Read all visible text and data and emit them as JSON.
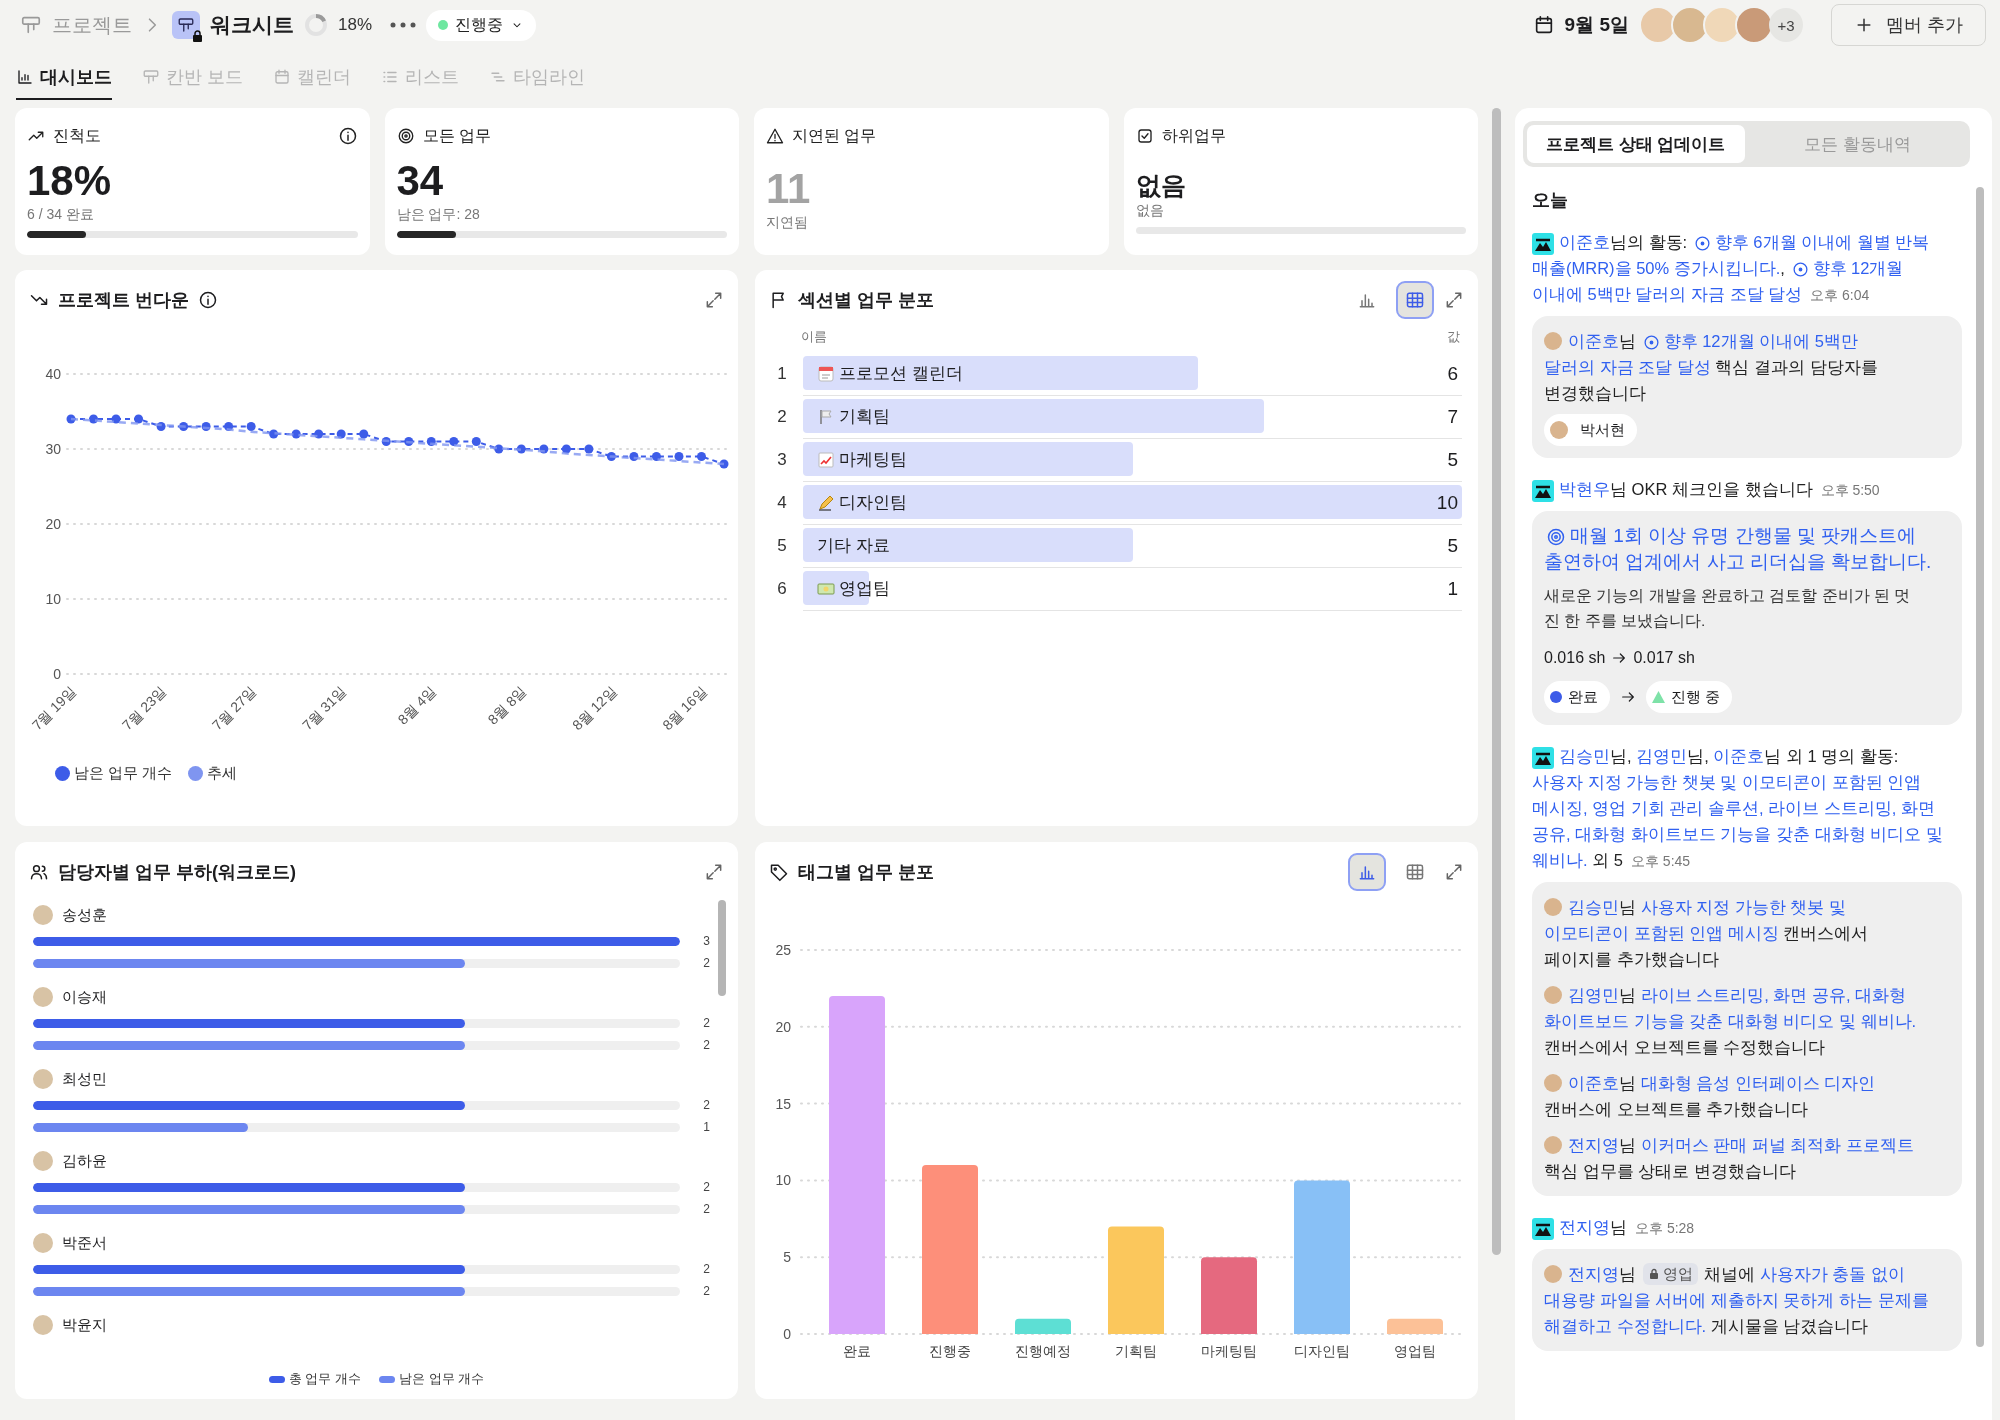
{
  "topbar": {
    "parent": "프로젝트",
    "title": "워크시트",
    "progress": {
      "level": 0.18,
      "reading": "18%"
    },
    "status": {
      "label": "진행중",
      "color": "#6ee7a0"
    },
    "date": "9월 5일",
    "members_more": "+3",
    "add_button": "멤버 추가"
  },
  "tabs": [
    {
      "label": "대시보드",
      "selected": true
    },
    {
      "label": "칸반 보드",
      "selected": false
    },
    {
      "label": "캘린더",
      "selected": false
    },
    {
      "label": "리스트",
      "selected": false
    },
    {
      "label": "타임라인",
      "selected": false
    }
  ],
  "stats": [
    {
      "kind": "percent",
      "title": "진척도",
      "info": true,
      "value": "18%",
      "caption": "6 / 34 완료",
      "level": 0.18
    },
    {
      "kind": "count",
      "title": "모든 업무",
      "info": false,
      "value": "34",
      "caption": "남은 업무: 28",
      "level": 0.18
    },
    {
      "kind": "overdue",
      "title": "지연된 업무",
      "info": false,
      "value": "11",
      "caption": "지연됨"
    },
    {
      "kind": "none",
      "title": "하위업무",
      "info": false,
      "value": "없음",
      "caption": "없음"
    }
  ],
  "burndown": {
    "title": "프로젝트 번다운",
    "chart_data": {
      "type": "line",
      "categories": [
        "7월 19일",
        null,
        null,
        null,
        "7월 23일",
        null,
        null,
        null,
        "7월 27일",
        null,
        null,
        null,
        "7월 31일",
        null,
        null,
        null,
        "8월 4일",
        null,
        null,
        null,
        "8월 8일",
        null,
        null,
        null,
        "8월 12일",
        null,
        null,
        null,
        "8월 16일",
        null
      ],
      "yticks": [
        0,
        10,
        20,
        30,
        40
      ],
      "ylim": [
        0,
        40
      ],
      "grid": true,
      "series": [
        {
          "name": "남은 업무 개수",
          "color": "#3d5ce8",
          "line_style": "dashed",
          "marker": "circle",
          "values": [
            34,
            34,
            34,
            34,
            33,
            33,
            33,
            33,
            33,
            32,
            32,
            32,
            32,
            32,
            31,
            31,
            31,
            31,
            31,
            30,
            30,
            30,
            30,
            30,
            29,
            29,
            29,
            29,
            29,
            28
          ]
        },
        {
          "name": "추세",
          "color": "#7f95f0",
          "line_style": "dashed",
          "values": [
            34,
            33.8,
            33.6,
            33.4,
            33.2,
            33,
            32.8,
            32.6,
            32.3,
            32.1,
            31.9,
            31.7,
            31.5,
            31.3,
            31.1,
            30.9,
            30.7,
            30.5,
            30.3,
            30.1,
            29.9,
            29.7,
            29.4,
            29.2,
            29,
            28.8,
            28.6,
            28.4,
            28.2,
            28
          ]
        }
      ]
    }
  },
  "sections": {
    "title": "섹션별 업무 분포",
    "views": [
      {
        "kind": "chart",
        "selected": false
      },
      {
        "kind": "table",
        "selected": true
      }
    ],
    "columns": [
      "이름",
      "값"
    ],
    "rows": [
      {
        "index": "1",
        "name": "프로모션 캘린더",
        "value": "6",
        "level": 0.6
      },
      {
        "index": "2",
        "name": "기획팀",
        "value": "7",
        "level": 0.7
      },
      {
        "index": "3",
        "name": "마케팅팀",
        "value": "5",
        "level": 0.5
      },
      {
        "index": "4",
        "name": "디자인팀",
        "value": "10",
        "level": 1
      },
      {
        "index": "5",
        "name": "기타 자료",
        "value": "5",
        "level": 0.5
      },
      {
        "index": "6",
        "name": "영업팀",
        "value": "1",
        "level": 0.1
      }
    ]
  },
  "workload": {
    "title": "담당자별 업무 부하(워크로드)",
    "people": [
      {
        "name": "송성훈",
        "total": {
          "reading": "3",
          "level": 1
        },
        "remaining": {
          "reading": "2",
          "level": 0.667
        }
      },
      {
        "name": "이승재",
        "total": {
          "reading": "2",
          "level": 0.667
        },
        "remaining": {
          "reading": "2",
          "level": 0.667
        }
      },
      {
        "name": "최성민",
        "total": {
          "reading": "2",
          "level": 0.667
        },
        "remaining": {
          "reading": "1",
          "level": 0.333
        }
      },
      {
        "name": "김하윤",
        "total": {
          "reading": "2",
          "level": 0.667
        },
        "remaining": {
          "reading": "2",
          "level": 0.667
        }
      },
      {
        "name": "박준서",
        "total": {
          "reading": "2",
          "level": 0.667
        },
        "remaining": {
          "reading": "2",
          "level": 0.667
        }
      },
      {
        "name": "박윤지"
      }
    ],
    "legend": [
      "총 업무 개수",
      "남은 업무 개수"
    ]
  },
  "tags": {
    "title": "태그별 업무 분포",
    "views": [
      {
        "kind": "chart",
        "selected": true
      },
      {
        "kind": "table",
        "selected": false
      }
    ],
    "chart_data": {
      "type": "bar",
      "categories": [
        "완료",
        "진행중",
        "진행예정",
        "기획팀",
        "마케팅팀",
        "디자인팀",
        "영업팀"
      ],
      "values": [
        22,
        11,
        1,
        7,
        5,
        10,
        1
      ],
      "yticks": [
        0,
        5,
        10,
        15,
        20,
        25
      ],
      "ylim": [
        0,
        25
      ],
      "grid": true
    }
  },
  "feed": {
    "tabs": [
      {
        "label": "프로젝트 상태 업데이트",
        "selected": true
      },
      {
        "label": "모든 활동내역",
        "selected": false
      }
    ],
    "day": "오늘",
    "items": [
      {
        "lines": [
          [
            {
              "kind": "link",
              "text": "이준호"
            },
            {
              "kind": "text",
              "text": "님의 활동: "
            },
            {
              "kind": "okr"
            },
            {
              "kind": "link",
              "text": "향후 6개월 이내에 월별 반복"
            }
          ],
          [
            {
              "kind": "link",
              "text": "매출(MRR)을 50% 증가시킵니다."
            },
            {
              "kind": "text",
              "text": ", "
            },
            {
              "kind": "okr"
            },
            {
              "kind": "link",
              "text": "향후 12개월"
            }
          ],
          [
            {
              "kind": "link",
              "text": "이내에 5백만 달러의 자금 조달 달성"
            }
          ]
        ],
        "time": "오후 6:04",
        "card": {
          "kind": "entries",
          "entries": [
            {
              "lines": [
                [
                  {
                    "kind": "link",
                    "text": "이준호"
                  },
                  {
                    "kind": "text",
                    "text": "님 "
                  },
                  {
                    "kind": "okr"
                  },
                  {
                    "kind": "link",
                    "text": "향후 12개월 이내에 5백만"
                  }
                ],
                [
                  {
                    "kind": "link",
                    "text": "달러의 자금 조달 달성"
                  },
                  {
                    "kind": "text",
                    "text": " 핵심 결과의 담당자를"
                  }
                ],
                [
                  {
                    "kind": "text",
                    "text": "변경했습니다"
                  }
                ]
              ]
            }
          ],
          "chip": "박서현"
        }
      },
      {
        "lines": [
          [
            {
              "kind": "link",
              "text": "박현우"
            },
            {
              "kind": "text",
              "text": "님 OKR 체크인을 했습니다"
            }
          ]
        ],
        "time": "오후 5:50",
        "card": {
          "kind": "checkin",
          "title_lines": [
            [
              {
                "kind": "target"
              },
              {
                "kind": "link",
                "text": "매월 1회 이상 유명 간행물 및 팟캐스트에"
              }
            ],
            [
              {
                "kind": "link",
                "text": "출연하여 업계에서 사고 리더십을 확보합니다."
              }
            ]
          ],
          "body_lines": [
            "새로운 기능의 개발을 완료하고 검토할 준비가 된 멋",
            "진 한 주를 보냈습니다."
          ],
          "metric": {
            "from": "0.016 sh",
            "to": "0.017 sh"
          },
          "status_change": [
            {
              "label": "완료",
              "color": "#3d5ce8"
            },
            {
              "label": "진행 중",
              "color": "#7ee2a8"
            }
          ]
        }
      },
      {
        "lines": [
          [
            {
              "kind": "link",
              "text": "김승민"
            },
            {
              "kind": "text",
              "text": "님, "
            },
            {
              "kind": "link",
              "text": "김영민"
            },
            {
              "kind": "text",
              "text": "님, "
            },
            {
              "kind": "link",
              "text": "이준호"
            },
            {
              "kind": "text",
              "text": "님 외 1 명의 활동:"
            }
          ],
          [
            {
              "kind": "link",
              "text": "사용자 지정 가능한 챗봇 및 이모티콘이 포함된 인앱"
            }
          ],
          [
            {
              "kind": "link",
              "text": "메시징, "
            },
            {
              "kind": "link",
              "text": "영업 기회 관리 솔루션, "
            },
            {
              "kind": "link",
              "text": "라이브 스트리밍, 화면"
            }
          ],
          [
            {
              "kind": "link",
              "text": "공유, 대화형 화이트보드 기능을 갖춘 대화형 비디오 및"
            }
          ],
          [
            {
              "kind": "link",
              "text": "웨비나."
            },
            {
              "kind": "text",
              "text": " 외 5"
            }
          ]
        ],
        "time": "오후 5:45",
        "card": {
          "kind": "entries",
          "entries": [
            {
              "lines": [
                [
                  {
                    "kind": "link",
                    "text": "김승민"
                  },
                  {
                    "kind": "text",
                    "text": "님 "
                  },
                  {
                    "kind": "link",
                    "text": "사용자 지정 가능한 챗봇 및"
                  }
                ],
                [
                  {
                    "kind": "link",
                    "text": "이모티콘이 포함된 인앱 메시징"
                  },
                  {
                    "kind": "text",
                    "text": " 캔버스에서"
                  }
                ],
                [
                  {
                    "kind": "text",
                    "text": "페이지를 추가했습니다"
                  }
                ]
              ]
            },
            {
              "lines": [
                [
                  {
                    "kind": "link",
                    "text": "김영민"
                  },
                  {
                    "kind": "text",
                    "text": "님 "
                  },
                  {
                    "kind": "link",
                    "text": "라이브 스트리밍, 화면 공유, 대화형"
                  }
                ],
                [
                  {
                    "kind": "link",
                    "text": "화이트보드 기능을 갖춘 대화형 비디오 및 웨비나."
                  }
                ],
                [
                  {
                    "kind": "text",
                    "text": "캔버스에서 오브젝트를 수정했습니다"
                  }
                ]
              ]
            },
            {
              "lines": [
                [
                  {
                    "kind": "link",
                    "text": "이준호"
                  },
                  {
                    "kind": "text",
                    "text": "님 "
                  },
                  {
                    "kind": "link",
                    "text": "대화형 음성 인터페이스 디자인"
                  }
                ],
                [
                  {
                    "kind": "text",
                    "text": "캔버스에 오브젝트를 추가했습니다"
                  }
                ]
              ]
            },
            {
              "lines": [
                [
                  {
                    "kind": "link",
                    "text": "전지영"
                  },
                  {
                    "kind": "text",
                    "text": "님 "
                  },
                  {
                    "kind": "link",
                    "text": "이커머스 판매 퍼널 최적화 프로젝트"
                  }
                ],
                [
                  {
                    "kind": "text",
                    "text": "핵심 업무를 상태로 변경했습니다"
                  }
                ]
              ]
            }
          ]
        }
      },
      {
        "lines": [
          [
            {
              "kind": "link",
              "text": "전지영"
            },
            {
              "kind": "text",
              "text": "님"
            }
          ]
        ],
        "time": "오후 5:28",
        "card": {
          "kind": "entries",
          "entries": [
            {
              "lines": [
                [
                  {
                    "kind": "link",
                    "text": "전지영"
                  },
                  {
                    "kind": "text",
                    "text": "님 "
                  },
                  {
                    "kind": "tag",
                    "text": "영업"
                  },
                  {
                    "kind": "text",
                    "text": " 채널에 "
                  },
                  {
                    "kind": "link",
                    "text": "사용자가 충돌 없이"
                  }
                ],
                [
                  {
                    "kind": "link",
                    "text": "대용량 파일을 서버에 제출하지 못하게 하는 문제를"
                  }
                ],
                [
                  {
                    "kind": "link",
                    "text": "해결하고 수정합니다."
                  },
                  {
                    "kind": "text",
                    "text": " 게시물을 남겼습니다"
                  }
                ]
              ]
            }
          ]
        }
      }
    ]
  }
}
